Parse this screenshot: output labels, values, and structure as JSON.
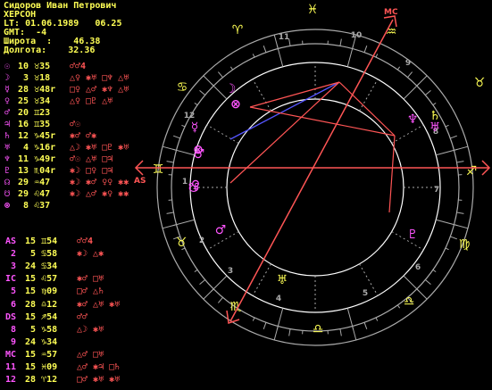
{
  "header": {
    "name": "Сидоров Иван Петрович",
    "city": "ХЕРСОН",
    "lt_label": "LT:",
    "lt_value": "01.06.1989   06.25",
    "gmt_label": "GMT:",
    "gmt_value": "-4",
    "lat_label": "Широта  :",
    "lat_value": "46.38",
    "lon_label": "Долгота:",
    "lon_value": "32.36"
  },
  "planets": [
    {
      "glyph": "☉",
      "pos": "10 ♉35",
      "asp": "♂♂4"
    },
    {
      "glyph": "☽",
      "pos": " 3 ♉18",
      "asp": "△♀ ✱♅ □♆ △♅"
    },
    {
      "glyph": "☿",
      "pos": "28 ♉48r",
      "asp": "□♀ △♂ ✱♆ △♅"
    },
    {
      "glyph": "♀",
      "pos": "25 ♉34",
      "asp": "△♀ □♇ △♅"
    },
    {
      "glyph": "♂",
      "pos": "20 ♊23",
      "asp": ""
    },
    {
      "glyph": "♃",
      "pos": "16 ♊35",
      "asp": "♂☉"
    },
    {
      "glyph": "♄",
      "pos": "12 ♑45r",
      "asp": "✱♂ ♂✱"
    },
    {
      "glyph": "♅",
      "pos": " 4 ♑16r",
      "asp": "△☽ ✱♅ □♇ ✱♅"
    },
    {
      "glyph": "♆",
      "pos": "11 ♑49r",
      "asp": "♂☉ △♅ □♃"
    },
    {
      "glyph": "♇",
      "pos": "13 ♏04r",
      "asp": "✱☽ □♀ □♃"
    },
    {
      "glyph": "☊",
      "pos": "29 ♒47",
      "asp": "✱☽ ✱♂ ♀♀ ✱✱"
    },
    {
      "glyph": "☋",
      "pos": "29 ♌47",
      "asp": "✱☽ △♂ ✱♀ ✱✱"
    },
    {
      "glyph": "⊗",
      "pos": " 8 ♌37",
      "asp": ""
    }
  ],
  "houses": [
    {
      "label": "AS",
      "pos": "15 ♊54",
      "asp": "♂♂4"
    },
    {
      "label": " 2",
      "pos": " 5 ♋58",
      "asp": "✱☽ △✱"
    },
    {
      "label": " 3",
      "pos": "24 ♋34",
      "asp": ""
    },
    {
      "label": "IC",
      "pos": "15 ♌57",
      "asp": "✱♂ □♅"
    },
    {
      "label": " 5",
      "pos": "15 ♍09",
      "asp": "□♂ △♄"
    },
    {
      "label": " 6",
      "pos": "28 ♎12",
      "asp": "✱♂ △♅ ✱♅"
    },
    {
      "label": "DS",
      "pos": "15 ♐54",
      "asp": "♂♂"
    },
    {
      "label": " 8",
      "pos": " 5 ♑58",
      "asp": "△☽ ✱♅"
    },
    {
      "label": " 9",
      "pos": "24 ♑34",
      "asp": ""
    },
    {
      "label": "MC",
      "pos": "15 ♒57",
      "asp": "△♂ □♅"
    },
    {
      "label": "11",
      "pos": "15 ♓09",
      "asp": "△♂ ✱♃ □♄"
    },
    {
      "label": "12",
      "pos": "28 ♈12",
      "asp": "□♂ ✱♅ ✱♅"
    }
  ],
  "wheel": {
    "signs": [
      "♉",
      "♊",
      "♋",
      "♌",
      "♍",
      "♎",
      "♏",
      "♐",
      "♑",
      "♒",
      "♓",
      "♈"
    ],
    "house_numbers": [
      "12",
      "1",
      "2",
      "3",
      "4",
      "5",
      "6",
      "7",
      "8",
      "9",
      "10",
      "11"
    ],
    "axis_labels": {
      "as": "AS",
      "mc": "MC"
    },
    "planet_glyphs": {
      "moon": "☽",
      "sun": "⊗",
      "merc": "☿",
      "venus": "♀",
      "mars": "♂",
      "jupiter": "♃",
      "pofort": "⊗",
      "node": "☊",
      "nep": "♆",
      "ura": "♅",
      "sat": "♄",
      "plu": "♇",
      "snode": "☋"
    }
  },
  "colors": {
    "bg": "#000000",
    "yellow": "#ffff55",
    "magenta": "#ff55ff",
    "red": "#ff5555",
    "blue": "#5555ff",
    "gray": "#aaaaaa",
    "white": "#ffffff"
  }
}
